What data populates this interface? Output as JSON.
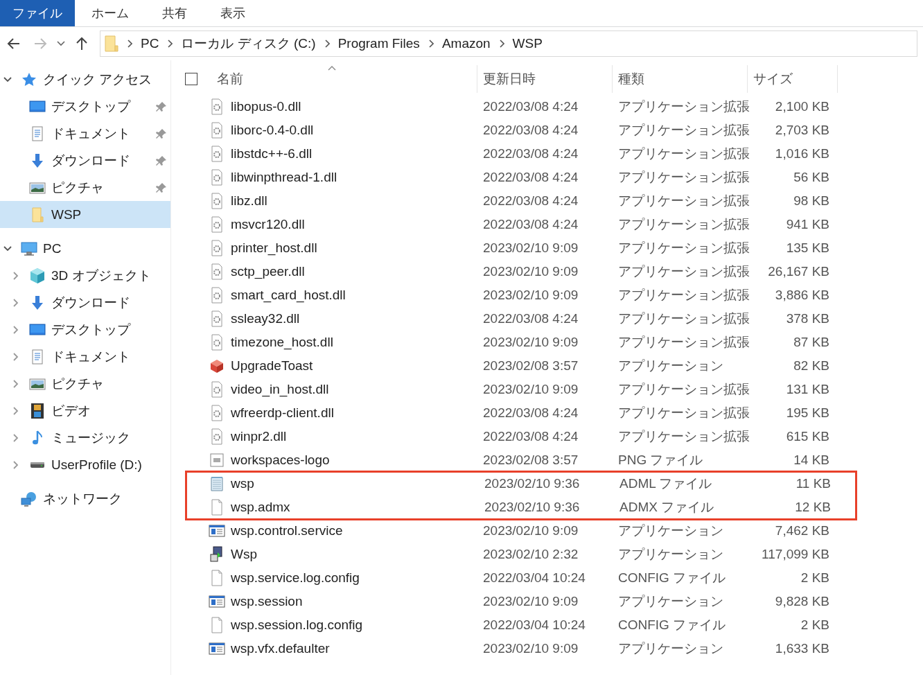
{
  "ribbon_tabs": [
    {
      "label": "ファイル",
      "selected": true
    },
    {
      "label": "ホーム",
      "selected": false
    },
    {
      "label": "共有",
      "selected": false
    },
    {
      "label": "表示",
      "selected": false
    }
  ],
  "breadcrumb": [
    "PC",
    "ローカル ディスク (C:)",
    "Program Files",
    "Amazon",
    "WSP"
  ],
  "sidebar": {
    "items": [
      {
        "label": "クイック アクセス",
        "kind": "star",
        "expanded": true,
        "selected": false,
        "children": [
          {
            "label": "デスクトップ",
            "kind": "desktop",
            "pinned": true,
            "selected": false
          },
          {
            "label": "ドキュメント",
            "kind": "document",
            "pinned": true,
            "selected": false
          },
          {
            "label": "ダウンロード",
            "kind": "download",
            "pinned": true,
            "selected": false
          },
          {
            "label": "ピクチャ",
            "kind": "picture",
            "pinned": true,
            "selected": false
          },
          {
            "label": "WSP",
            "kind": "folder",
            "pinned": false,
            "selected": true
          }
        ]
      },
      {
        "label": "PC",
        "kind": "computer",
        "expanded": true,
        "selected": false,
        "children": [
          {
            "label": "3D オブジェクト",
            "kind": "cube",
            "expanded": false,
            "selected": false
          },
          {
            "label": "ダウンロード",
            "kind": "download",
            "expanded": false,
            "selected": false
          },
          {
            "label": "デスクトップ",
            "kind": "desktop",
            "expanded": false,
            "selected": false
          },
          {
            "label": "ドキュメント",
            "kind": "document",
            "expanded": false,
            "selected": false
          },
          {
            "label": "ピクチャ",
            "kind": "picture",
            "expanded": false,
            "selected": false
          },
          {
            "label": "ビデオ",
            "kind": "video",
            "expanded": false,
            "selected": false
          },
          {
            "label": "ミュージック",
            "kind": "music",
            "expanded": false,
            "selected": false
          },
          {
            "label": "UserProfile (D:)",
            "kind": "drive",
            "expanded": false,
            "selected": false
          }
        ]
      },
      {
        "label": "ネットワーク",
        "kind": "network",
        "selected": false
      }
    ]
  },
  "table": {
    "select_all": {
      "checked": false
    },
    "columns": [
      "名前",
      "更新日時",
      "種類",
      "サイズ"
    ],
    "rows": [
      {
        "kind": "dll",
        "name": "libopus-0.dll",
        "date": "2022/03/08 4:24",
        "type": "アプリケーション拡張",
        "size": "2,100 KB",
        "highlighted": false
      },
      {
        "kind": "dll",
        "name": "liborc-0.4-0.dll",
        "date": "2022/03/08 4:24",
        "type": "アプリケーション拡張",
        "size": "2,703 KB",
        "highlighted": false
      },
      {
        "kind": "dll",
        "name": "libstdc++-6.dll",
        "date": "2022/03/08 4:24",
        "type": "アプリケーション拡張",
        "size": "1,016 KB",
        "highlighted": false
      },
      {
        "kind": "dll",
        "name": "libwinpthread-1.dll",
        "date": "2022/03/08 4:24",
        "type": "アプリケーション拡張",
        "size": "56 KB",
        "highlighted": false
      },
      {
        "kind": "dll",
        "name": "libz.dll",
        "date": "2022/03/08 4:24",
        "type": "アプリケーション拡張",
        "size": "98 KB",
        "highlighted": false
      },
      {
        "kind": "dll",
        "name": "msvcr120.dll",
        "date": "2022/03/08 4:24",
        "type": "アプリケーション拡張",
        "size": "941 KB",
        "highlighted": false
      },
      {
        "kind": "dll",
        "name": "printer_host.dll",
        "date": "2023/02/10 9:09",
        "type": "アプリケーション拡張",
        "size": "135 KB",
        "highlighted": false
      },
      {
        "kind": "dll",
        "name": "sctp_peer.dll",
        "date": "2023/02/10 9:09",
        "type": "アプリケーション拡張",
        "size": "26,167 KB",
        "highlighted": false
      },
      {
        "kind": "dll",
        "name": "smart_card_host.dll",
        "date": "2023/02/10 9:09",
        "type": "アプリケーション拡張",
        "size": "3,886 KB",
        "highlighted": false
      },
      {
        "kind": "dll",
        "name": "ssleay32.dll",
        "date": "2022/03/08 4:24",
        "type": "アプリケーション拡張",
        "size": "378 KB",
        "highlighted": false
      },
      {
        "kind": "dll",
        "name": "timezone_host.dll",
        "date": "2023/02/10 9:09",
        "type": "アプリケーション拡張",
        "size": "87 KB",
        "highlighted": false
      },
      {
        "kind": "toast",
        "name": "UpgradeToast",
        "date": "2023/02/08 3:57",
        "type": "アプリケーション",
        "size": "82 KB",
        "highlighted": false
      },
      {
        "kind": "dll",
        "name": "video_in_host.dll",
        "date": "2023/02/10 9:09",
        "type": "アプリケーション拡張",
        "size": "131 KB",
        "highlighted": false
      },
      {
        "kind": "dll",
        "name": "wfreerdp-client.dll",
        "date": "2022/03/08 4:24",
        "type": "アプリケーション拡張",
        "size": "195 KB",
        "highlighted": false
      },
      {
        "kind": "dll",
        "name": "winpr2.dll",
        "date": "2022/03/08 4:24",
        "type": "アプリケーション拡張",
        "size": "615 KB",
        "highlighted": false
      },
      {
        "kind": "image",
        "name": "workspaces-logo",
        "date": "2023/02/08 3:57",
        "type": "PNG ファイル",
        "size": "14 KB",
        "highlighted": false
      },
      {
        "kind": "notepad",
        "name": "wsp",
        "date": "2023/02/10 9:36",
        "type": "ADML ファイル",
        "size": "11 KB",
        "highlighted": true
      },
      {
        "kind": "blank",
        "name": "wsp.admx",
        "date": "2023/02/10 9:36",
        "type": "ADMX ファイル",
        "size": "12 KB",
        "highlighted": true
      },
      {
        "kind": "app",
        "name": "wsp.control.service",
        "date": "2023/02/10 9:09",
        "type": "アプリケーション",
        "size": "7,462 KB",
        "highlighted": false
      },
      {
        "kind": "installer",
        "name": "Wsp",
        "date": "2023/02/10 2:32",
        "type": "アプリケーション",
        "size": "117,099 KB",
        "highlighted": false
      },
      {
        "kind": "blank",
        "name": "wsp.service.log.config",
        "date": "2022/03/04 10:24",
        "type": "CONFIG ファイル",
        "size": "2 KB",
        "highlighted": false
      },
      {
        "kind": "app",
        "name": "wsp.session",
        "date": "2023/02/10 9:09",
        "type": "アプリケーション",
        "size": "9,828 KB",
        "highlighted": false
      },
      {
        "kind": "blank",
        "name": "wsp.session.log.config",
        "date": "2022/03/04 10:24",
        "type": "CONFIG ファイル",
        "size": "2 KB",
        "highlighted": false
      },
      {
        "kind": "app",
        "name": "wsp.vfx.defaulter",
        "date": "2023/02/10 9:09",
        "type": "アプリケーション",
        "size": "1,633 KB",
        "highlighted": false
      }
    ]
  }
}
